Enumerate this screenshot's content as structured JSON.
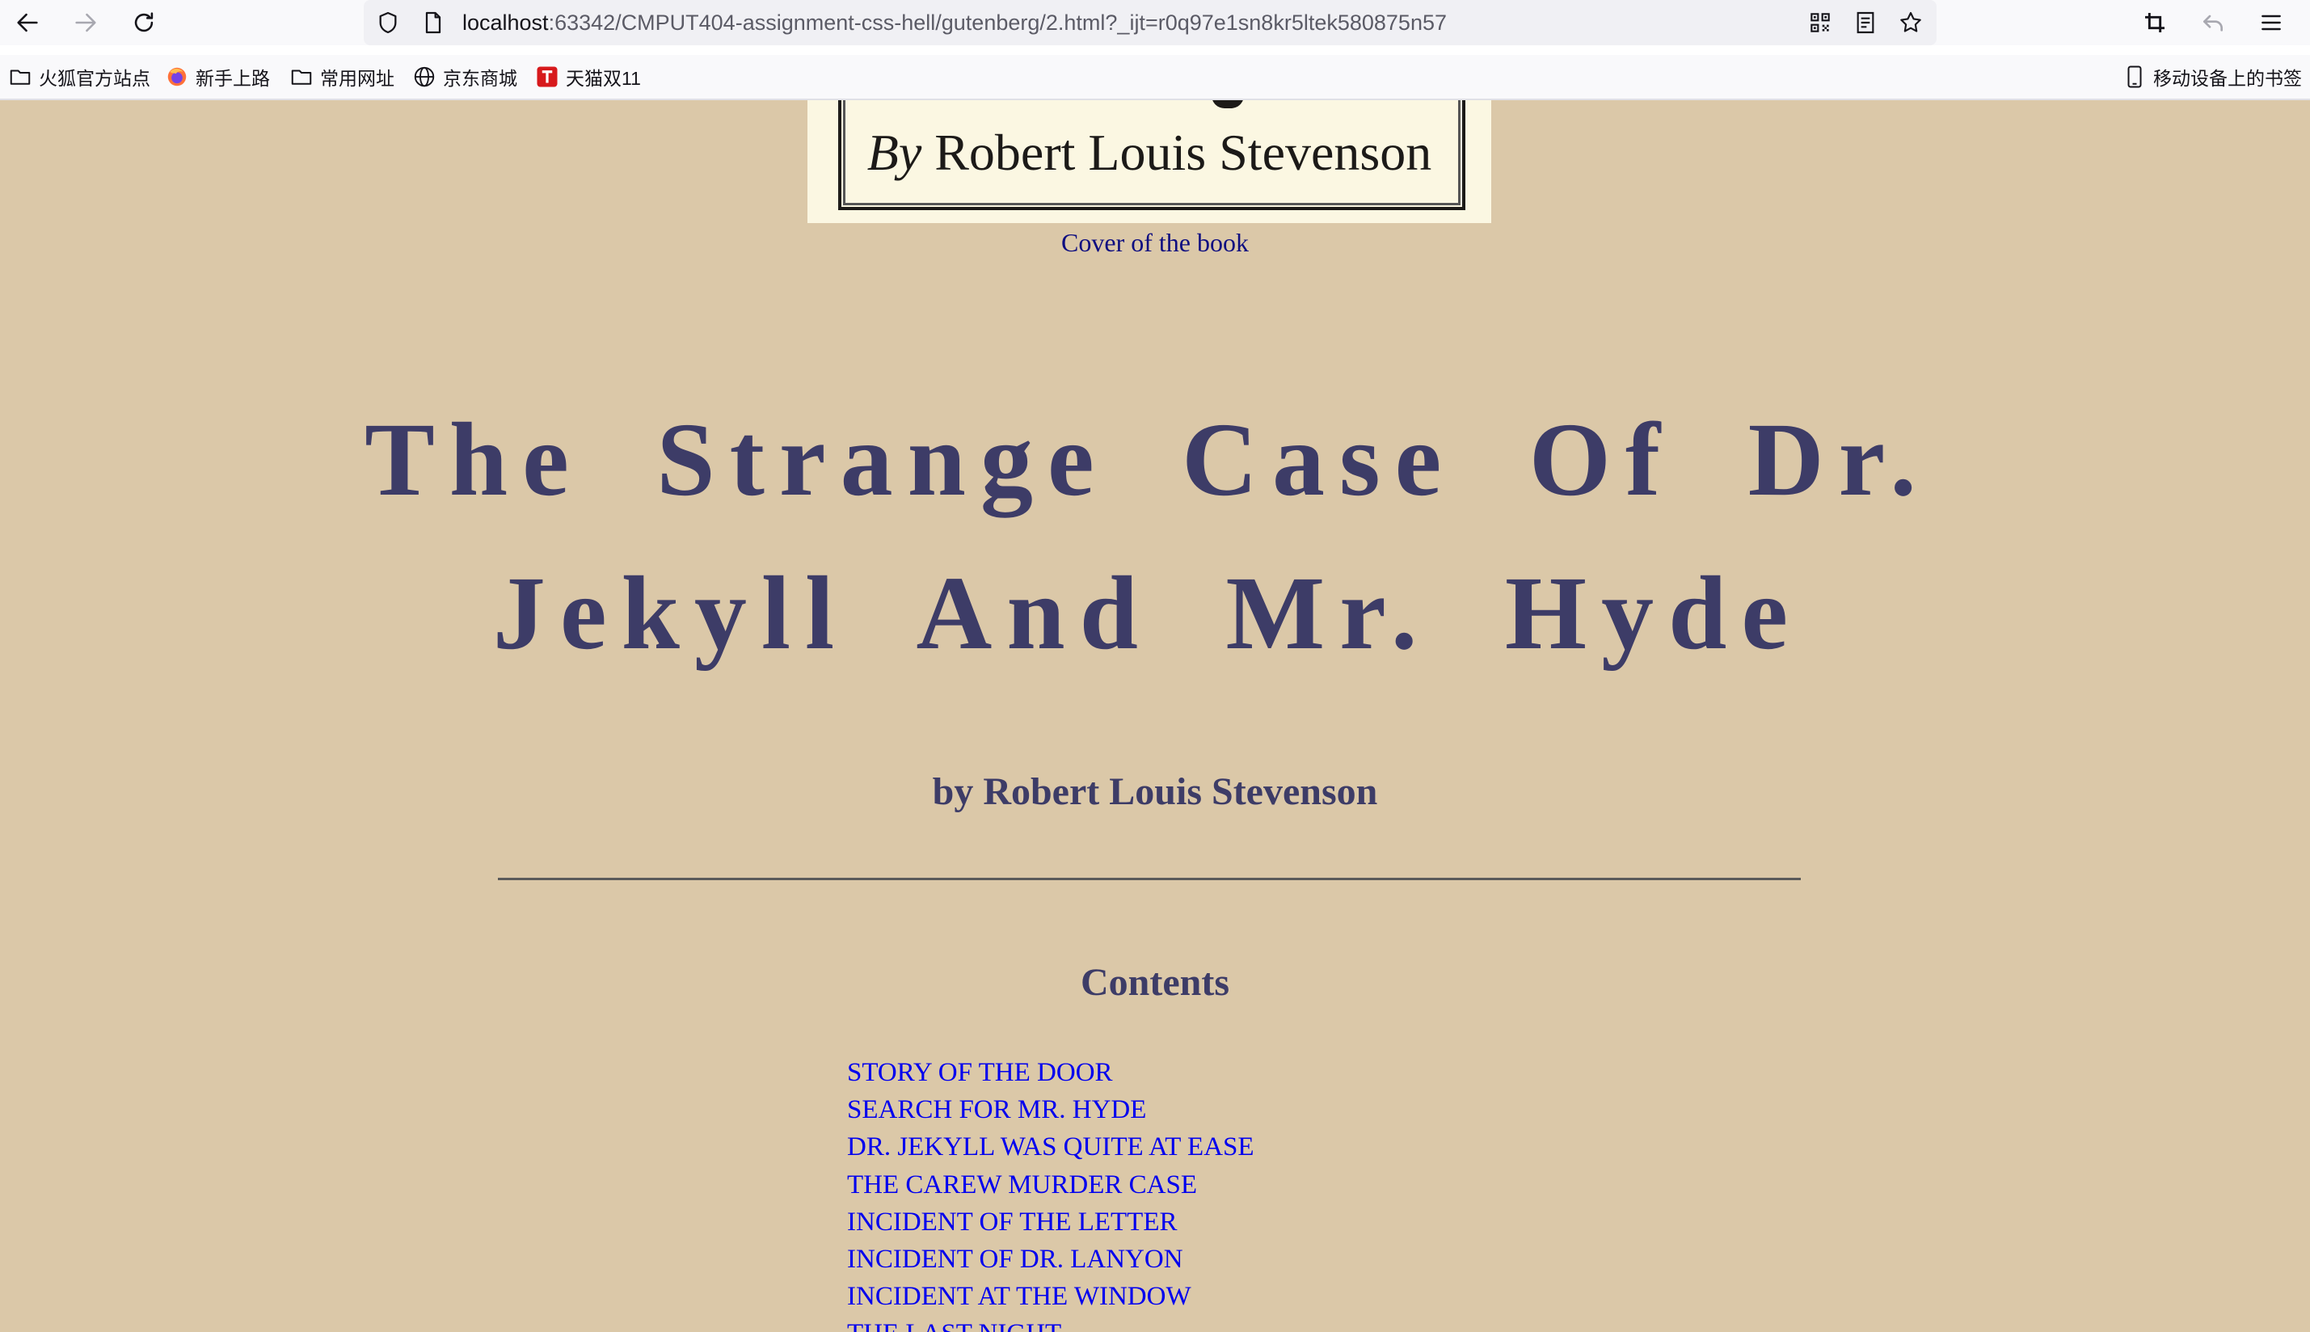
{
  "browser": {
    "url_host": "localhost",
    "url_rest": ":63342/CMPUT404-assignment-css-hell/gutenberg/2.html?_ijt=r0q97e1sn8kr5ltek580875n57",
    "bookmarks": [
      {
        "label": "火狐官方站点",
        "icon": "folder-icon"
      },
      {
        "label": "新手上路",
        "icon": "firefox-icon"
      },
      {
        "label": "常用网址",
        "icon": "folder-icon"
      },
      {
        "label": "京东商城",
        "icon": "globe-icon"
      },
      {
        "label": "天猫双11",
        "icon": "tmall-icon"
      }
    ],
    "mobile_bookmarks": "移动设备上的书签"
  },
  "page": {
    "cover_by": "By",
    "cover_author": "Robert Louis Stevenson",
    "cover_caption": "Cover of the book",
    "title_line1": "The Strange Case Of Dr.",
    "title_line2": "Jekyll And Mr. Hyde",
    "author": "by Robert Louis Stevenson",
    "contents_heading": "Contents",
    "toc": [
      "STORY OF THE DOOR",
      "SEARCH FOR MR. HYDE",
      "DR. JEKYLL WAS QUITE AT EASE",
      "THE CAREW MURDER CASE",
      "INCIDENT OF THE LETTER",
      "INCIDENT OF DR. LANYON",
      "INCIDENT AT THE WINDOW",
      "THE LAST NIGHT"
    ]
  },
  "colors": {
    "page_background": "#dbc8a8",
    "heading": "#3d3c67",
    "link": "#0000ee",
    "caption": "#0d0d80"
  }
}
